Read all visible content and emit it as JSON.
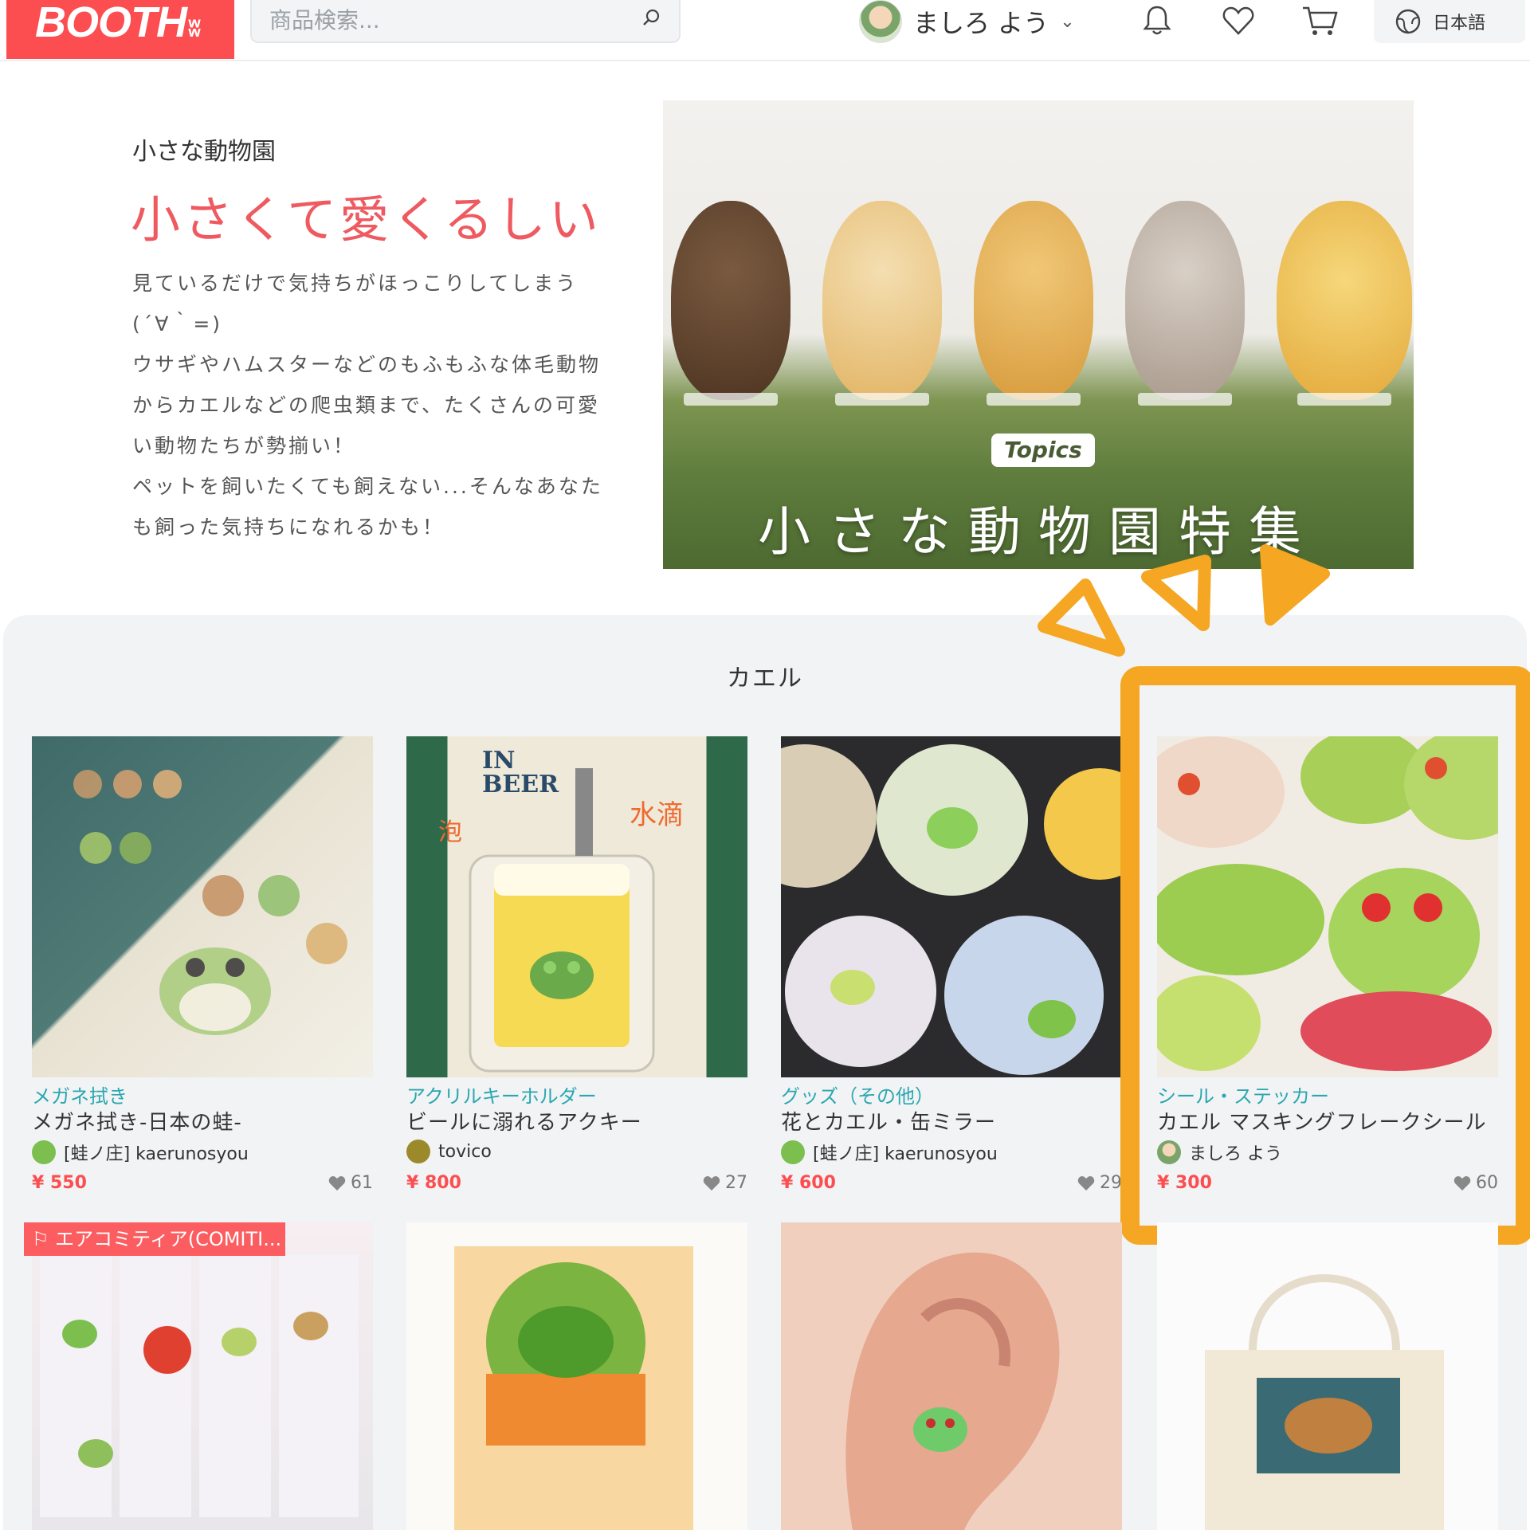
{
  "header": {
    "logo": "BOOTH",
    "search_placeholder": "商品検索...",
    "user_name": "ましろ よう",
    "language": "日本語"
  },
  "hero": {
    "kicker": "小さな動物園",
    "title": "小さくて愛くるしい",
    "description": "見ているだけで気持ちがほっこりしてしまう\n(´∀｀=)\nウサギやハムスターなどのもふもふな体毛動物\nからカエルなどの爬虫類まで、たくさんの可愛\nい動物たちが勢揃い！\nペットを飼いたくても飼えない...そんなあなた\nも飼った気持ちになれるかも！",
    "banner_tag": "Topics",
    "banner_title": "小さな動物園特集"
  },
  "section": {
    "title": "カエル",
    "products": [
      {
        "category": "メガネ拭き",
        "name": "メガネ拭き-日本の蛙-",
        "shop": "[蛙ノ庄] kaerunosyou",
        "price": "¥ 550",
        "likes": "61"
      },
      {
        "category": "アクリルキーホルダー",
        "name": "ビールに溺れるアクキー",
        "shop": "tovico",
        "price": "¥ 800",
        "likes": "27"
      },
      {
        "category": "グッズ（その他）",
        "name": "花とカエル・缶ミラー",
        "shop": "[蛙ノ庄] kaerunosyou",
        "price": "¥ 600",
        "likes": "29"
      },
      {
        "category": "シール・ステッカー",
        "name": "カエル マスキングフレークシール",
        "shop": "ましろ よう",
        "price": "¥ 300",
        "likes": "60"
      }
    ],
    "event_tag": "エアコミティア(COMITI..."
  },
  "colors": {
    "brand": "#fc4d50",
    "accent_highlight": "#f5a623",
    "category_text": "#2aa7b0",
    "hero_title": "#ee5a5f"
  }
}
